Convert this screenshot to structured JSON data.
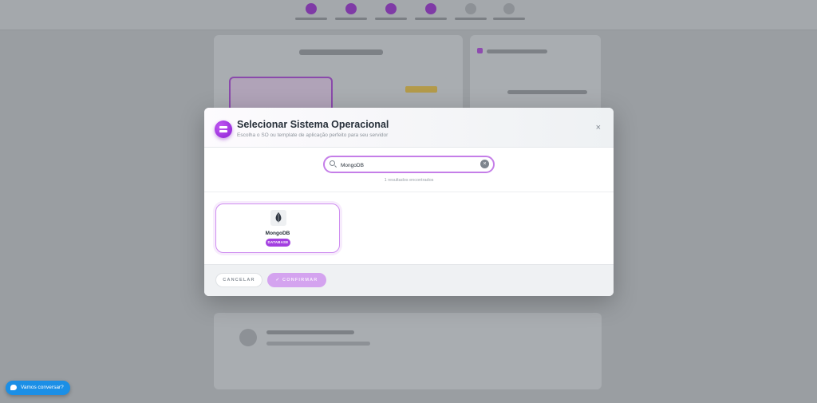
{
  "modal": {
    "title": "Selecionar Sistema Operacional",
    "subtitle": "Escolha o SO ou template de aplicação perfeito para seu servidor",
    "close_label": "×",
    "icon": "server-icon"
  },
  "search": {
    "value": "MongoDB",
    "clear_label": "×",
    "result_count": "1 resultados encontrados"
  },
  "results": [
    {
      "name": "MongoDB",
      "badge": "DATABASE",
      "icon": "mongodb-leaf-icon"
    }
  ],
  "footer": {
    "cancel_label": "CANCELAR",
    "confirm_label": "✓ CONFIRMAR"
  },
  "chat": {
    "label": "Vamos conversar?"
  },
  "colors": {
    "accent": "#a33fe0",
    "accent_light": "#d4a3ef",
    "chat": "#1b8fe6"
  }
}
